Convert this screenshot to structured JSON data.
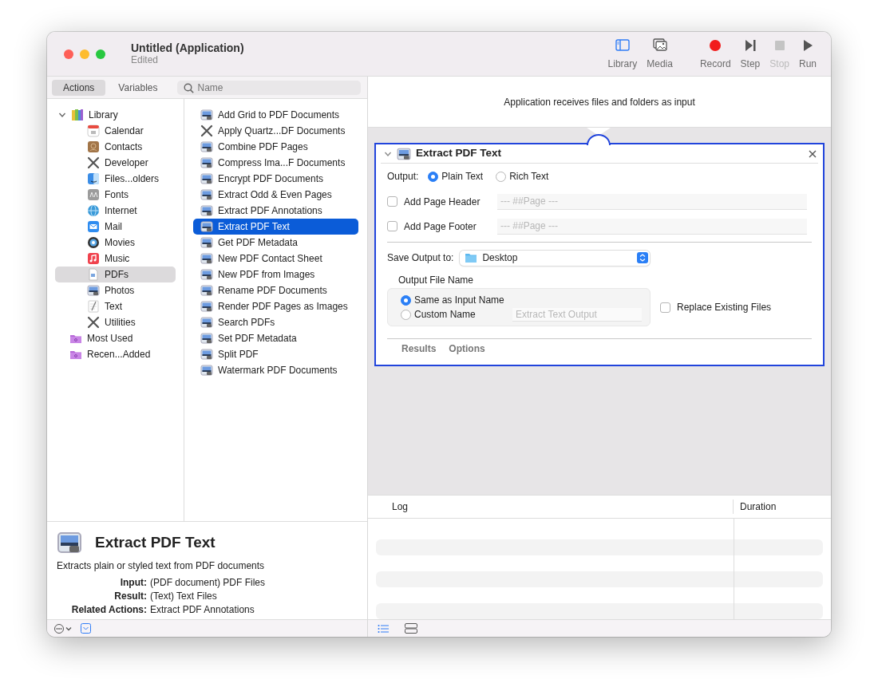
{
  "window": {
    "title": "Untitled (Application)",
    "subtitle": "Edited"
  },
  "toolbar": [
    {
      "label": "Library",
      "kind": "library",
      "active": true,
      "disabled": false
    },
    {
      "label": "Media",
      "kind": "media",
      "active": false,
      "disabled": false
    },
    {
      "label": "Record",
      "kind": "record",
      "active": false,
      "disabled": false
    },
    {
      "label": "Step",
      "kind": "step",
      "active": false,
      "disabled": false
    },
    {
      "label": "Stop",
      "kind": "stop",
      "active": false,
      "disabled": true
    },
    {
      "label": "Run",
      "kind": "run",
      "active": false,
      "disabled": false
    }
  ],
  "library_tabs": [
    {
      "label": "Actions",
      "selected": true
    },
    {
      "label": "Variables",
      "selected": false
    }
  ],
  "search": {
    "placeholder": "Name"
  },
  "categories": [
    {
      "label": "Library",
      "kind": "books",
      "expanded": true,
      "selected": false,
      "children": [
        {
          "label": "Calendar",
          "kind": "calendar",
          "selected": false
        },
        {
          "label": "Contacts",
          "kind": "contacts",
          "selected": false
        },
        {
          "label": "Developer",
          "kind": "tools",
          "selected": false
        },
        {
          "label": "Files...olders",
          "kind": "finder",
          "selected": false
        },
        {
          "label": "Fonts",
          "kind": "fonts",
          "selected": false
        },
        {
          "label": "Internet",
          "kind": "globe",
          "selected": false
        },
        {
          "label": "Mail",
          "kind": "mail",
          "selected": false
        },
        {
          "label": "Movies",
          "kind": "movies",
          "selected": false
        },
        {
          "label": "Music",
          "kind": "music",
          "selected": false
        },
        {
          "label": "PDFs",
          "kind": "document",
          "selected": true
        },
        {
          "label": "Photos",
          "kind": "picture",
          "selected": false
        },
        {
          "label": "Text",
          "kind": "notepad",
          "selected": false
        },
        {
          "label": "Utilities",
          "kind": "tools",
          "selected": false
        }
      ]
    },
    {
      "label": "Most Used",
      "kind": "folder",
      "selected": false
    },
    {
      "label": "Recen...Added",
      "kind": "folder",
      "selected": false
    }
  ],
  "actions": [
    {
      "label": "Add Grid to PDF Documents",
      "kind": "picture",
      "selected": false
    },
    {
      "label": "Apply Quartz...DF Documents",
      "kind": "tools",
      "selected": false
    },
    {
      "label": "Combine PDF Pages",
      "kind": "picture",
      "selected": false
    },
    {
      "label": "Compress Ima...F Documents",
      "kind": "picture",
      "selected": false
    },
    {
      "label": "Encrypt PDF Documents",
      "kind": "picture",
      "selected": false
    },
    {
      "label": "Extract Odd & Even Pages",
      "kind": "picture",
      "selected": false
    },
    {
      "label": "Extract PDF Annotations",
      "kind": "picture",
      "selected": false
    },
    {
      "label": "Extract PDF Text",
      "kind": "picture",
      "selected": true
    },
    {
      "label": "Get PDF Metadata",
      "kind": "picture",
      "selected": false
    },
    {
      "label": "New PDF Contact Sheet",
      "kind": "picture",
      "selected": false
    },
    {
      "label": "New PDF from Images",
      "kind": "picture",
      "selected": false
    },
    {
      "label": "Rename PDF Documents",
      "kind": "picture",
      "selected": false
    },
    {
      "label": "Render PDF Pages as Images",
      "kind": "picture",
      "selected": false
    },
    {
      "label": "Search PDFs",
      "kind": "picture",
      "selected": false
    },
    {
      "label": "Set PDF Metadata",
      "kind": "picture",
      "selected": false
    },
    {
      "label": "Split PDF",
      "kind": "picture",
      "selected": false
    },
    {
      "label": "Watermark PDF Documents",
      "kind": "picture",
      "selected": false
    }
  ],
  "description": {
    "title": "Extract PDF Text",
    "summary": "Extracts plain or styled text from PDF documents",
    "details": [
      {
        "label": "Input:",
        "value": "(PDF document) PDF Files"
      },
      {
        "label": "Result:",
        "value": "(Text) Text Files"
      },
      {
        "label": "Related Actions:",
        "value": "Extract PDF Annotations"
      }
    ]
  },
  "workflow": {
    "input_note": "Application receives files and folders as input",
    "action": {
      "title": "Extract PDF Text",
      "expanded": true,
      "output_label": "Output:",
      "output_options": [
        {
          "label": "Plain Text",
          "selected": true
        },
        {
          "label": "Rich Text",
          "selected": false
        }
      ],
      "page_options": [
        {
          "label": "Add Page Header",
          "checked": false,
          "placeholder": "--- ##Page ---"
        },
        {
          "label": "Add Page Footer",
          "checked": false,
          "placeholder": "--- ##Page ---"
        }
      ],
      "save_label": "Save Output to:",
      "save_location": "Desktop",
      "file_name_label": "Output File Name",
      "file_name_options": [
        {
          "label": "Same as Input Name",
          "selected": true
        },
        {
          "label": "Custom Name",
          "selected": false,
          "placeholder": "Extract Text Output"
        }
      ],
      "replace": {
        "label": "Replace Existing Files",
        "checked": false
      },
      "footer_tabs": [
        "Results",
        "Options"
      ]
    }
  },
  "log": {
    "columns": [
      "Log",
      "Duration"
    ]
  }
}
